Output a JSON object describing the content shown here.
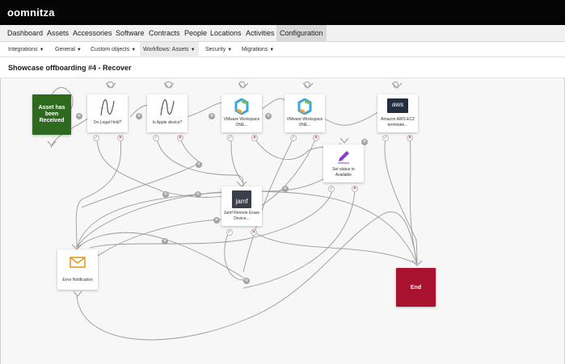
{
  "app": {
    "logo": "oomnitza"
  },
  "main_nav": [
    "Dashboard",
    "Assets",
    "Accessories",
    "Software",
    "Contracts",
    "People",
    "Locations",
    "Activities",
    "Configuration"
  ],
  "sub_nav": [
    "Integrations",
    "General",
    "Custom objects",
    "Workflows: Assets",
    "Security",
    "Migrations"
  ],
  "page_title": "Showcase offboarding #4 - Recover",
  "nodes": {
    "start": "Asset has been Received",
    "legal_hold": "On Legal Hold?",
    "apple": "Is Apple device?",
    "vmware1": "VMware Workspace ONE...",
    "vmware2": "VMware Workspace ONE...",
    "aws": "Amazon AWS EC2 terminate...",
    "aws_logo": "aws",
    "status": "Set status to Available",
    "jamf": "Jamf Remote Erase Device...",
    "jamf_logo": "jamf",
    "error": "Error Notification",
    "end": "End"
  },
  "colors": {
    "start": "#2e6a1e",
    "end": "#a8122e",
    "pencil": "#8a3fd1",
    "envelope": "#e39a2c"
  },
  "icons": [
    "decision-curve-icon",
    "workspace-one-icon",
    "aws-logo-icon",
    "pencil-icon",
    "jamf-logo-icon",
    "envelope-icon",
    "check-icon",
    "close-icon",
    "caret-down-icon"
  ]
}
